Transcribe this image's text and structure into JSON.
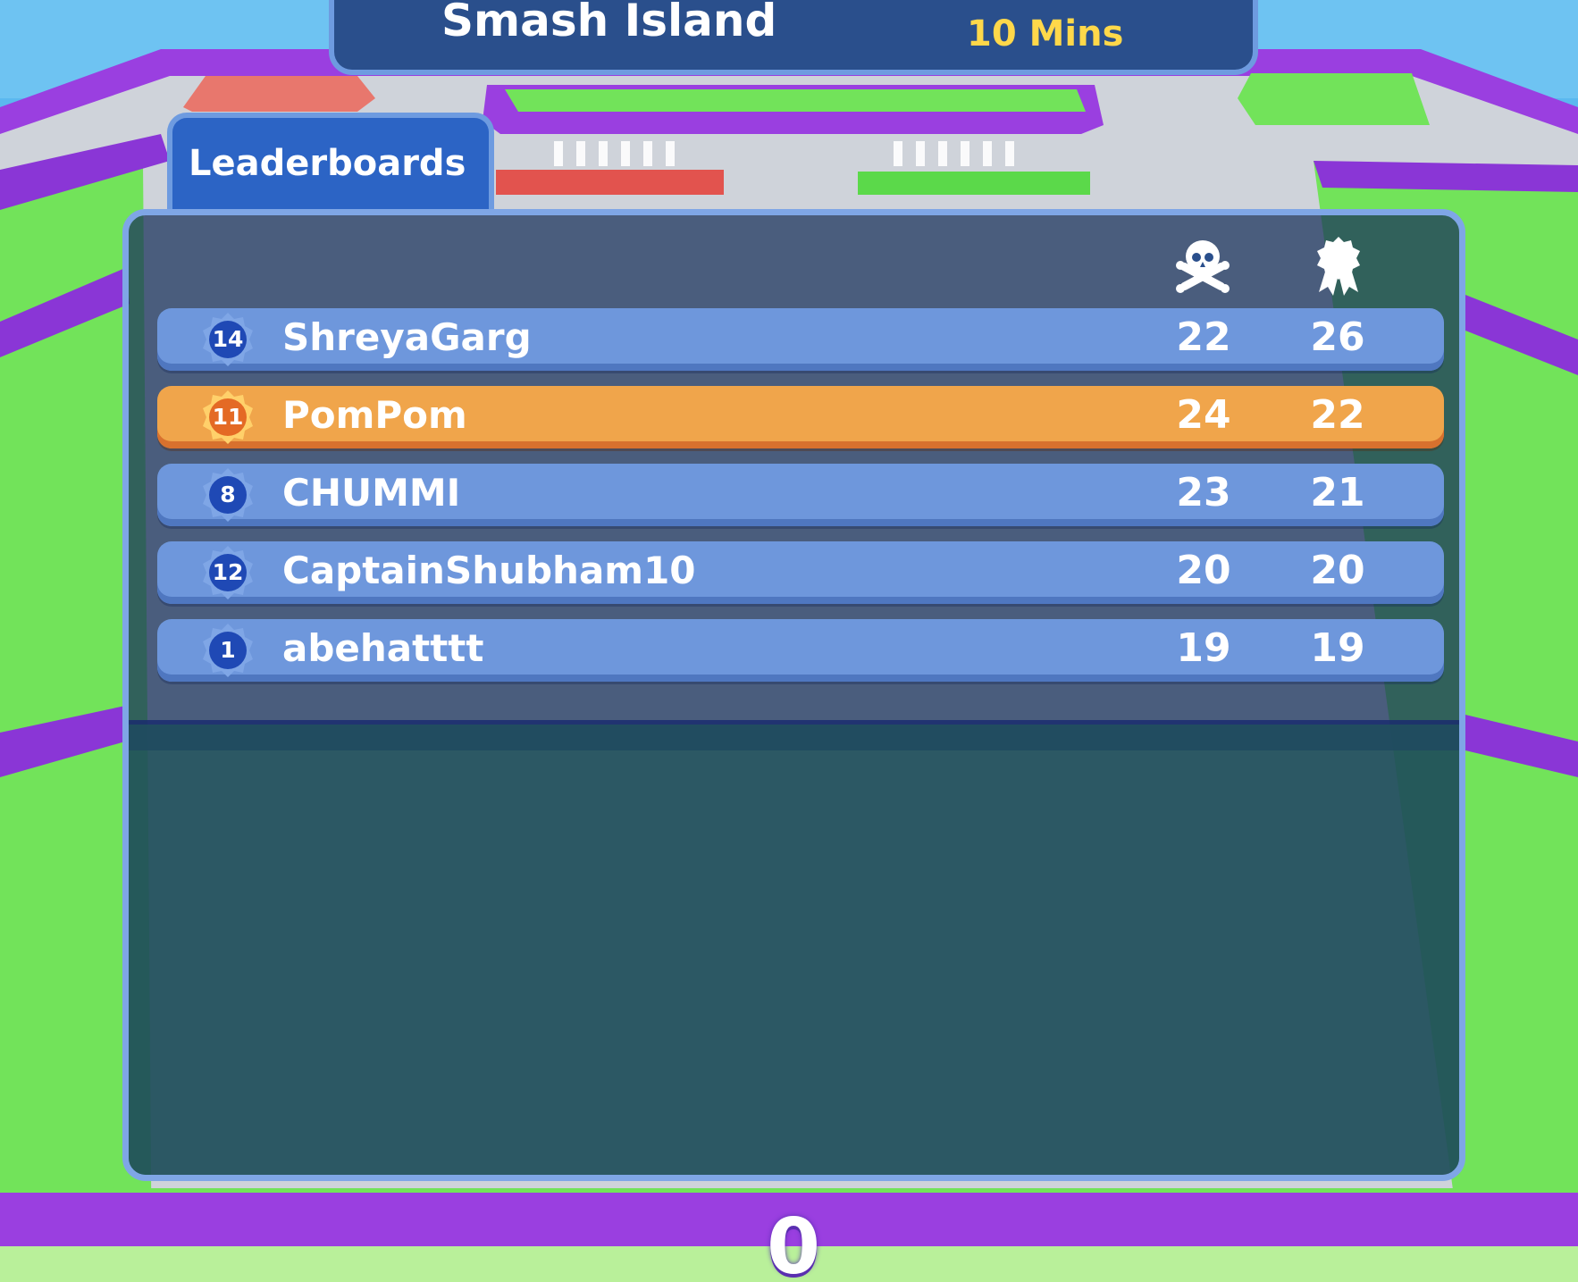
{
  "header": {
    "map_name": "Smash Island",
    "duration": "10 Mins"
  },
  "tab": {
    "label": "Leaderboards"
  },
  "columns": {
    "kills_icon": "skull-crossbones-icon",
    "score_icon": "award-ribbon-icon"
  },
  "leaderboard": [
    {
      "rank": "14",
      "name": "ShreyaGarg",
      "kills": "22",
      "score": "26",
      "highlighted": false
    },
    {
      "rank": "11",
      "name": "PomPom",
      "kills": "24",
      "score": "22",
      "highlighted": true
    },
    {
      "rank": "8",
      "name": "CHUMMI",
      "kills": "23",
      "score": "21",
      "highlighted": false
    },
    {
      "rank": "12",
      "name": "CaptainShubham10",
      "kills": "20",
      "score": "20",
      "highlighted": false
    },
    {
      "rank": "1",
      "name": "abehatttt",
      "kills": "19",
      "score": "19",
      "highlighted": false
    }
  ],
  "bottom_counter": "0",
  "colors": {
    "row": "#6e97dc",
    "highlight_row": "#f0a54b",
    "duration_text": "#ffd84a",
    "panel_border": "#7fa6e6"
  }
}
